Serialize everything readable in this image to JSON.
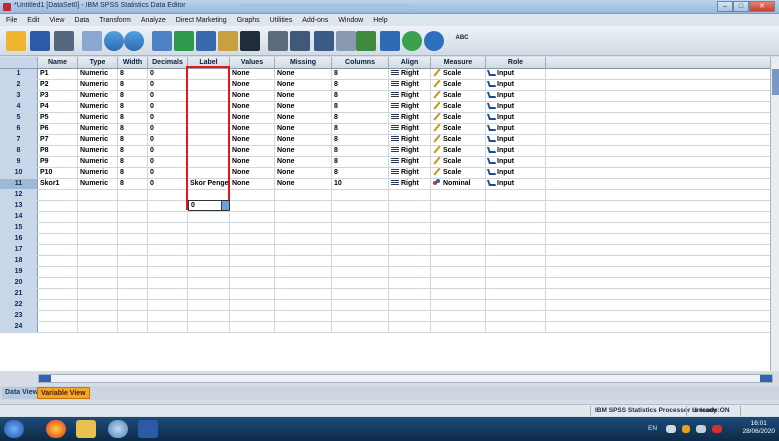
{
  "window": {
    "title": "*Untitled1 [DataSet0] - IBM SPSS Statistics Data Editor",
    "buttons": {
      "minimize": "–",
      "maximize": "□",
      "close": "✕"
    }
  },
  "menu": [
    "File",
    "Edit",
    "View",
    "Data",
    "Transform",
    "Analyze",
    "Direct Marketing",
    "Graphs",
    "Utilities",
    "Add-ons",
    "Window",
    "Help"
  ],
  "toolbar": {
    "icons": [
      "open-folder-icon",
      "save-icon",
      "print-icon",
      "dialog-recall-icon",
      "undo-icon",
      "redo-icon",
      "goto-case-icon",
      "goto-variable-icon",
      "variables-icon",
      "run-descriptives-icon",
      "find-icon",
      "insert-cases-icon",
      "insert-variable-icon",
      "split-file-icon",
      "weight-cases-icon",
      "select-cases-icon",
      "value-labels-icon",
      "use-variable-sets-icon",
      "show-all-variables-icon",
      "spell-check-icon"
    ],
    "spell_label": "ABC"
  },
  "grid": {
    "columns": [
      "Name",
      "Type",
      "Width",
      "Decimals",
      "Label",
      "Values",
      "Missing",
      "Columns",
      "Align",
      "Measure",
      "Role"
    ],
    "rows": [
      {
        "num": "1",
        "name": "P1",
        "type": "Numeric",
        "width": "8",
        "decimals": "0",
        "label": "",
        "values": "None",
        "missing": "None",
        "columns": "8",
        "align": "Right",
        "measure": "Scale",
        "role": "Input"
      },
      {
        "num": "2",
        "name": "P2",
        "type": "Numeric",
        "width": "8",
        "decimals": "0",
        "label": "",
        "values": "None",
        "missing": "None",
        "columns": "8",
        "align": "Right",
        "measure": "Scale",
        "role": "Input"
      },
      {
        "num": "3",
        "name": "P3",
        "type": "Numeric",
        "width": "8",
        "decimals": "0",
        "label": "",
        "values": "None",
        "missing": "None",
        "columns": "8",
        "align": "Right",
        "measure": "Scale",
        "role": "Input"
      },
      {
        "num": "4",
        "name": "P4",
        "type": "Numeric",
        "width": "8",
        "decimals": "0",
        "label": "",
        "values": "None",
        "missing": "None",
        "columns": "8",
        "align": "Right",
        "measure": "Scale",
        "role": "Input"
      },
      {
        "num": "5",
        "name": "P5",
        "type": "Numeric",
        "width": "8",
        "decimals": "0",
        "label": "",
        "values": "None",
        "missing": "None",
        "columns": "8",
        "align": "Right",
        "measure": "Scale",
        "role": "Input"
      },
      {
        "num": "6",
        "name": "P6",
        "type": "Numeric",
        "width": "8",
        "decimals": "0",
        "label": "",
        "values": "None",
        "missing": "None",
        "columns": "8",
        "align": "Right",
        "measure": "Scale",
        "role": "Input"
      },
      {
        "num": "7",
        "name": "P7",
        "type": "Numeric",
        "width": "8",
        "decimals": "0",
        "label": "",
        "values": "None",
        "missing": "None",
        "columns": "8",
        "align": "Right",
        "measure": "Scale",
        "role": "Input"
      },
      {
        "num": "8",
        "name": "P8",
        "type": "Numeric",
        "width": "8",
        "decimals": "0",
        "label": "",
        "values": "None",
        "missing": "None",
        "columns": "8",
        "align": "Right",
        "measure": "Scale",
        "role": "Input"
      },
      {
        "num": "9",
        "name": "P9",
        "type": "Numeric",
        "width": "8",
        "decimals": "0",
        "label": "",
        "values": "None",
        "missing": "None",
        "columns": "8",
        "align": "Right",
        "measure": "Scale",
        "role": "Input"
      },
      {
        "num": "10",
        "name": "P10",
        "type": "Numeric",
        "width": "8",
        "decimals": "0",
        "label": "",
        "values": "None",
        "missing": "None",
        "columns": "8",
        "align": "Right",
        "measure": "Scale",
        "role": "Input"
      },
      {
        "num": "11",
        "name": "Skor1",
        "type": "Numeric",
        "width": "8",
        "decimals": "0",
        "label": "Skor Pengetah...",
        "values": "None",
        "missing": "None",
        "columns": "10",
        "align": "Right",
        "measure": "Nominal",
        "role": "Input"
      }
    ],
    "empty_rows": [
      "12",
      "13",
      "14",
      "15",
      "16",
      "17",
      "18",
      "19",
      "20",
      "21",
      "22",
      "23",
      "24"
    ]
  },
  "tabs": {
    "data_view": "Data View",
    "variable_view": "Variable View"
  },
  "status": {
    "processor": "IBM SPSS Statistics Processor is ready",
    "encoding": "Unicode:ON"
  },
  "taskbar": {
    "lang": "EN",
    "time": "16:01",
    "date": "28/06/2020"
  },
  "colors": {
    "highlight": "#e01818",
    "active_tab": "#f4a52a",
    "row_header": "#c8d6ea"
  }
}
